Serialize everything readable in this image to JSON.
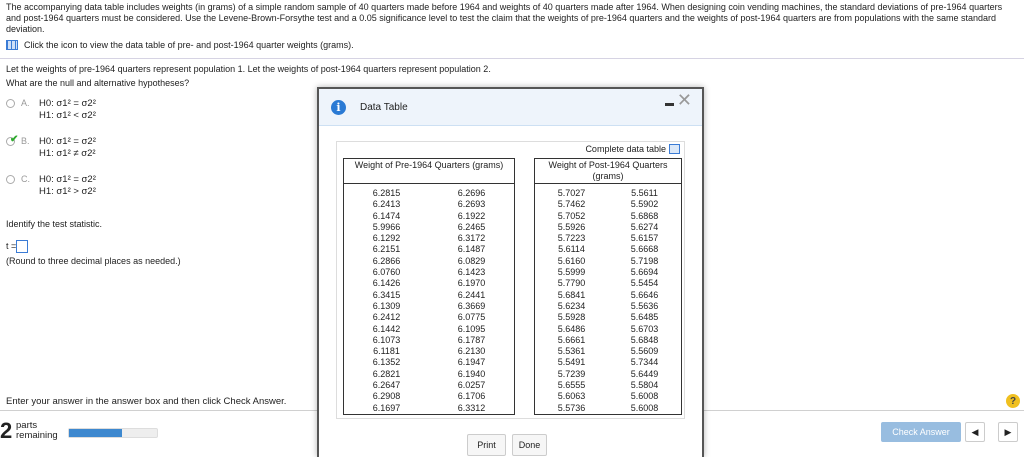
{
  "intro": "The accompanying data table includes weights (in grams) of a simple random sample of 40 quarters made before 1964 and weights of 40 quarters made after 1964. When designing coin vending machines, the standard deviations of pre-1964 quarters and post-1964 quarters must be considered. Use the Levene-Brown-Forsythe test and a 0.05 significance level to test the claim that the weights of pre-1964 quarters and the weights of post-1964 quarters are from populations with the same standard deviation.",
  "table_link": "Click the icon to view the data table of pre- and post-1964 quarter weights (grams).",
  "population_text": "Let the weights of pre-1964 quarters represent population 1. Let the weights of post-1964 quarters represent population 2.",
  "question": "What are the null and alternative hypotheses?",
  "options": [
    {
      "letter": "A.",
      "h0": "H0: σ1² = σ2²",
      "h1": "H1: σ1² < σ2²",
      "selected": false
    },
    {
      "letter": "B.",
      "h0": "H0: σ1² = σ2²",
      "h1": "H1: σ1² ≠ σ2²",
      "selected": true
    },
    {
      "letter": "C.",
      "h0": "H0: σ1² = σ2²",
      "h1": "H1: σ1² > σ2²",
      "selected": false
    }
  ],
  "identify": "Identify the test statistic.",
  "t_label": "t =",
  "round_note": "(Round to three decimal places as needed.)",
  "footer_instruction": "Enter your answer in the answer box and then click Check Answer.",
  "parts_count": "2",
  "parts_label_1": "parts",
  "parts_label_2": "remaining",
  "progress_percent": 60,
  "check_answer": "Check Answer",
  "modal": {
    "title": "Data Table",
    "complete_link": "Complete data table",
    "pre_header": "Weight of Pre-1964 Quarters (grams)",
    "post_header": "Weight of Post-1964 Quarters (grams)",
    "pre_rows": [
      [
        "6.2815",
        "6.2696"
      ],
      [
        "6.2413",
        "6.2693"
      ],
      [
        "6.1474",
        "6.1922"
      ],
      [
        "5.9966",
        "6.2465"
      ],
      [
        "6.1292",
        "6.3172"
      ],
      [
        "6.2151",
        "6.1487"
      ],
      [
        "6.2866",
        "6.0829"
      ],
      [
        "6.0760",
        "6.1423"
      ],
      [
        "6.1426",
        "6.1970"
      ],
      [
        "6.3415",
        "6.2441"
      ],
      [
        "6.1309",
        "6.3669"
      ],
      [
        "6.2412",
        "6.0775"
      ],
      [
        "6.1442",
        "6.1095"
      ],
      [
        "6.1073",
        "6.1787"
      ],
      [
        "6.1181",
        "6.2130"
      ],
      [
        "6.1352",
        "6.1947"
      ],
      [
        "6.2821",
        "6.1940"
      ],
      [
        "6.2647",
        "6.0257"
      ],
      [
        "6.2908",
        "6.1706"
      ],
      [
        "6.1697",
        "6.3312"
      ]
    ],
    "post_rows": [
      [
        "5.7027",
        "5.5611"
      ],
      [
        "5.7462",
        "5.5902"
      ],
      [
        "5.7052",
        "5.6868"
      ],
      [
        "5.5926",
        "5.6274"
      ],
      [
        "5.7223",
        "5.6157"
      ],
      [
        "5.6114",
        "5.6668"
      ],
      [
        "5.6160",
        "5.7198"
      ],
      [
        "5.5999",
        "5.6694"
      ],
      [
        "5.7790",
        "5.5454"
      ],
      [
        "5.6841",
        "5.6646"
      ],
      [
        "5.6234",
        "5.5636"
      ],
      [
        "5.5928",
        "5.6485"
      ],
      [
        "5.6486",
        "5.6703"
      ],
      [
        "5.6661",
        "5.6848"
      ],
      [
        "5.5361",
        "5.5609"
      ],
      [
        "5.5491",
        "5.7344"
      ],
      [
        "5.7239",
        "5.6449"
      ],
      [
        "5.6555",
        "5.5804"
      ],
      [
        "5.6063",
        "5.6008"
      ],
      [
        "5.5736",
        "5.6008"
      ]
    ],
    "print": "Print",
    "done": "Done"
  }
}
